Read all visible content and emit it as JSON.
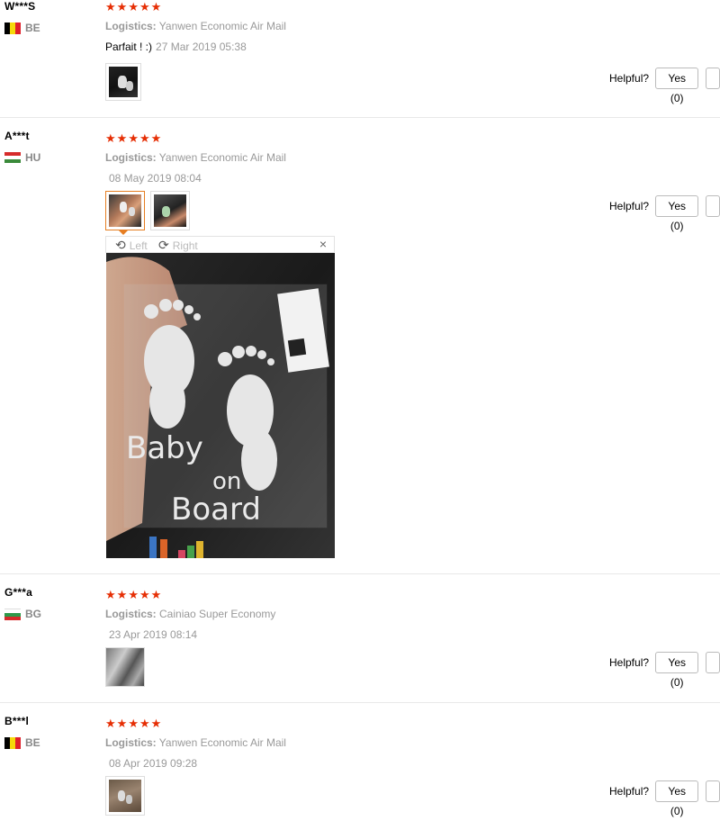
{
  "reviews": [
    {
      "user": "W***S",
      "country": "BE",
      "stars": 5,
      "logistics_label": "Logistics:",
      "logistics": "Yanwen Economic Air Mail",
      "text": "Parfait ! :)",
      "date": "27 Mar 2019 05:38",
      "helpful_label": "Helpful?",
      "yes_label": "Yes (0)"
    },
    {
      "user": "A***t",
      "country": "HU",
      "stars": 5,
      "logistics_label": "Logistics:",
      "logistics": "Yanwen Economic Air Mail",
      "text": "",
      "date": "08 May 2019 08:04",
      "helpful_label": "Helpful?",
      "yes_label": "Yes (0)"
    },
    {
      "user": "G***a",
      "country": "BG",
      "stars": 5,
      "logistics_label": "Logistics:",
      "logistics": "Cainiao Super Economy",
      "text": "",
      "date": "23 Apr 2019 08:14",
      "helpful_label": "Helpful?",
      "yes_label": "Yes (0)"
    },
    {
      "user": "B***l",
      "country": "BE",
      "stars": 5,
      "logistics_label": "Logistics:",
      "logistics": "Yanwen Economic Air Mail",
      "text": "",
      "date": "08 Apr 2019 09:28",
      "helpful_label": "Helpful?",
      "yes_label": "Yes (0)"
    }
  ],
  "viewer": {
    "rotate_left": "Left",
    "rotate_right": "Right",
    "close": "×",
    "image_caption_line1": "Baby",
    "image_caption_line2": "on",
    "image_caption_line3": "Board"
  },
  "colors": {
    "star": "#e62e04",
    "active_thumb": "#e67e22"
  }
}
